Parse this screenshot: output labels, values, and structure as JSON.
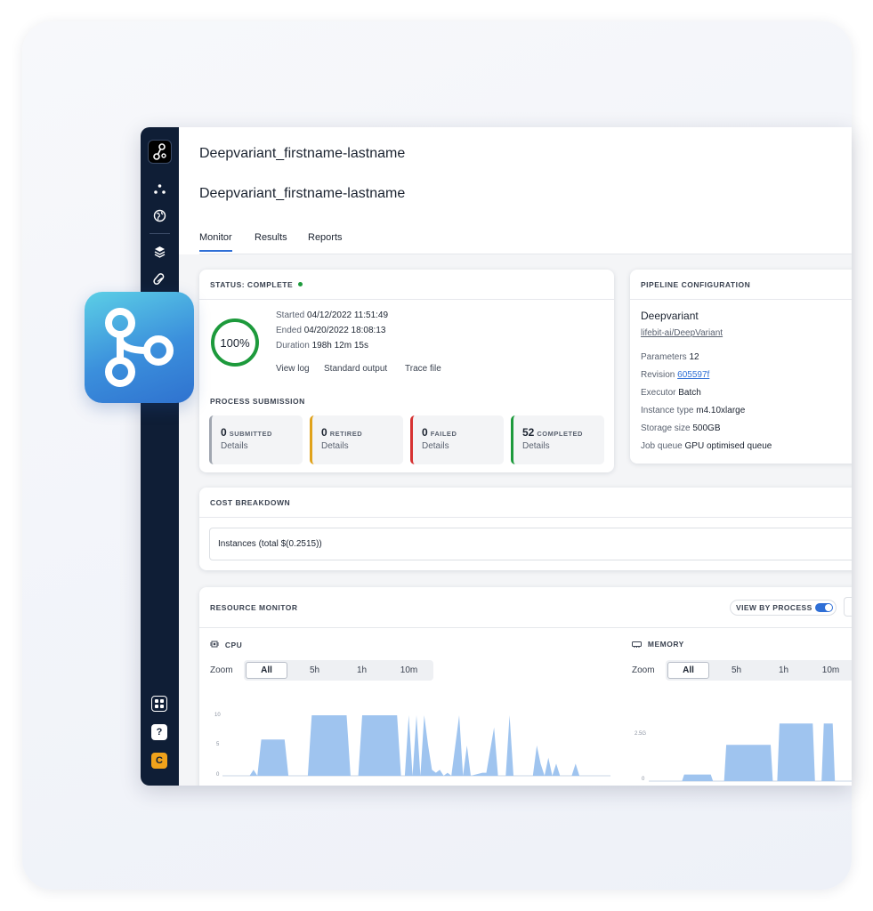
{
  "header": {
    "title": "Deepvariant_firstname-lastname",
    "subtitle": "Deepvariant_firstname-lastname"
  },
  "tabs": [
    {
      "label": "Monitor",
      "active": true
    },
    {
      "label": "Results",
      "active": false
    },
    {
      "label": "Reports",
      "active": false
    }
  ],
  "status": {
    "heading": "STATUS: COMPLETE",
    "progress_label": "100%",
    "progress_fraction": 1.0,
    "started_label": "Started",
    "started_value": "04/12/2022 11:51:49",
    "ended_label": "Ended",
    "ended_value": "04/20/2022 18:08:13",
    "duration_label": "Duration",
    "duration_value": "198h 12m 15s",
    "links": [
      "View log",
      "Standard output",
      "Trace file"
    ],
    "color": "#1d9a3c"
  },
  "process_submission": {
    "heading": "PROCESS SUBMISSION",
    "items": [
      {
        "count": "0",
        "label": "SUBMITTED",
        "details": "Details",
        "color": "#a0a6b0"
      },
      {
        "count": "0",
        "label": "RETIRED",
        "details": "Details",
        "color": "#e0a21b"
      },
      {
        "count": "0",
        "label": "FAILED",
        "details": "Details",
        "color": "#d63232"
      },
      {
        "count": "52",
        "label": "COMPLETED",
        "details": "Details",
        "color": "#1d9a3c"
      }
    ]
  },
  "pipeline": {
    "heading": "PIPELINE CONFIGURATION",
    "name": "Deepvariant",
    "repo": "lifebit-ai/DeepVariant",
    "parameters_label": "Parameters",
    "parameters_value": "12",
    "revision_label": "Revision",
    "revision_value": "605597f",
    "executor_label": "Executor",
    "executor_value": "Batch",
    "instance_label": "Instance type",
    "instance_value": "m4.10xlarge",
    "storage_label": "Storage size",
    "storage_value": "500GB",
    "queue_label": "Job queue",
    "queue_value": "GPU optimised queue"
  },
  "cost": {
    "heading": "COST BREAKDOWN",
    "instances_row": "Instances (total $(0.2515))"
  },
  "resource_monitor": {
    "heading": "RESOURCE MONITOR",
    "view_by_process": "VIEW BY PROCESS",
    "view_by_process_on": true,
    "cpu": {
      "label": "CPU",
      "zoom_label": "Zoom",
      "zoom_options": [
        "All",
        "5h",
        "1h",
        "10m"
      ],
      "zoom_selected": "All",
      "y_ticks": [
        "10",
        "5",
        "0"
      ]
    },
    "memory": {
      "label": "MEMORY",
      "zoom_label": "Zoom",
      "zoom_options": [
        "All",
        "5h",
        "1h",
        "10m"
      ],
      "zoom_selected": "All",
      "y_ticks": [
        "2.5G",
        "0"
      ]
    }
  },
  "sidebar": {
    "help_label": "?",
    "user_initial": "C"
  },
  "colors": {
    "accent": "#2f6fd6",
    "sidebar_bg": "#0f1e36",
    "chart_fill": "#9fc4ef",
    "user_badge": "#f0a21b"
  },
  "chart_data": [
    {
      "type": "area",
      "title": "CPU",
      "ylim": [
        0,
        10
      ],
      "x_domain": [
        0,
        100
      ],
      "series": [
        {
          "values": [
            [
              0,
              0
            ],
            [
              7,
              0
            ],
            [
              8,
              1
            ],
            [
              9,
              0
            ],
            [
              10,
              6
            ],
            [
              16,
              6
            ],
            [
              17,
              0
            ],
            [
              22,
              0
            ],
            [
              23,
              10
            ],
            [
              32,
              10
            ],
            [
              33,
              0
            ],
            [
              35,
              0
            ],
            [
              36,
              10
            ],
            [
              45,
              10
            ],
            [
              46,
              0
            ],
            [
              47,
              0
            ],
            [
              48,
              10
            ],
            [
              49,
              0
            ],
            [
              50,
              10
            ],
            [
              51,
              0
            ],
            [
              52,
              10
            ],
            [
              53,
              5
            ],
            [
              54,
              1
            ],
            [
              55,
              0.5
            ],
            [
              56,
              1
            ],
            [
              57,
              0
            ],
            [
              58,
              0.5
            ],
            [
              59,
              0
            ],
            [
              61,
              10
            ],
            [
              62,
              0
            ],
            [
              63,
              5
            ],
            [
              64,
              0
            ],
            [
              67,
              0.5
            ],
            [
              68,
              0.5
            ],
            [
              70,
              8
            ],
            [
              71,
              0
            ],
            [
              73,
              0
            ],
            [
              74,
              10
            ],
            [
              75,
              0
            ],
            [
              80,
              0
            ],
            [
              81,
              5
            ],
            [
              82,
              2
            ],
            [
              83,
              0
            ],
            [
              84,
              3
            ],
            [
              85,
              0
            ],
            [
              86,
              2
            ],
            [
              87,
              0
            ],
            [
              89,
              0
            ],
            [
              90,
              0
            ],
            [
              91,
              2
            ],
            [
              92,
              0
            ],
            [
              100,
              0
            ]
          ]
        }
      ]
    },
    {
      "type": "area",
      "title": "MEMORY",
      "ylim": [
        0,
        4
      ],
      "x_domain": [
        0,
        100
      ],
      "series": [
        {
          "values": [
            [
              0,
              0
            ],
            [
              15,
              0
            ],
            [
              16,
              0.4
            ],
            [
              28,
              0.4
            ],
            [
              29,
              0
            ],
            [
              34,
              0
            ],
            [
              35,
              2.2
            ],
            [
              55,
              2.2
            ],
            [
              56,
              0
            ],
            [
              58,
              0
            ],
            [
              59,
              3.5
            ],
            [
              74,
              3.5
            ],
            [
              75,
              0
            ],
            [
              78,
              0
            ],
            [
              79,
              3.5
            ],
            [
              83,
              3.5
            ],
            [
              84,
              0
            ],
            [
              100,
              0
            ]
          ]
        }
      ]
    }
  ]
}
